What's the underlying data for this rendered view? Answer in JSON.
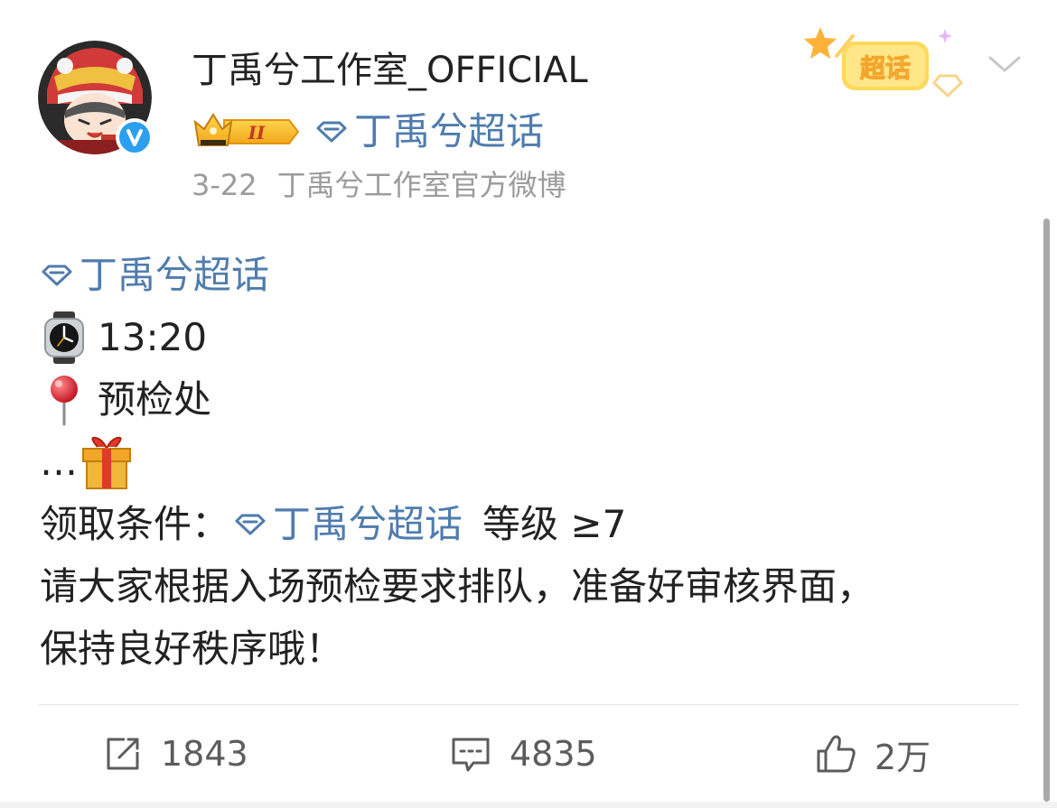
{
  "post": {
    "author": "丁禹兮工作室_OFFICIAL",
    "supertopic": "丁禹兮超话",
    "fan_level_badge": "II",
    "date": "3-22",
    "source": "丁禹兮工作室官方微博",
    "chaohua_label": "超话",
    "verified_color": "#2d9ff0",
    "link_color": "#4f7cae",
    "lines": {
      "topic": "丁禹兮超话",
      "time": "13:20",
      "place": "预检处",
      "ellipsis": "…",
      "condition_prefix": "领取条件：",
      "condition_topic": "丁禹兮超话",
      "condition_level": "等级 ≥7",
      "notice_1": "请大家根据入场预检要求排队，准备好审核界面，",
      "notice_2": "保持良好秩序哦！"
    },
    "actions": {
      "repost_count": "1843",
      "comment_count": "4835",
      "like_count": "2万"
    },
    "icons": {
      "watch": "watch-icon",
      "pin": "round-pushpin-icon",
      "gift": "gift-icon",
      "gem": "supertopic-gem-icon",
      "repost": "repost-icon",
      "comment": "comment-icon",
      "like": "thumbs-up-icon",
      "more": "chevron-down-icon"
    }
  }
}
